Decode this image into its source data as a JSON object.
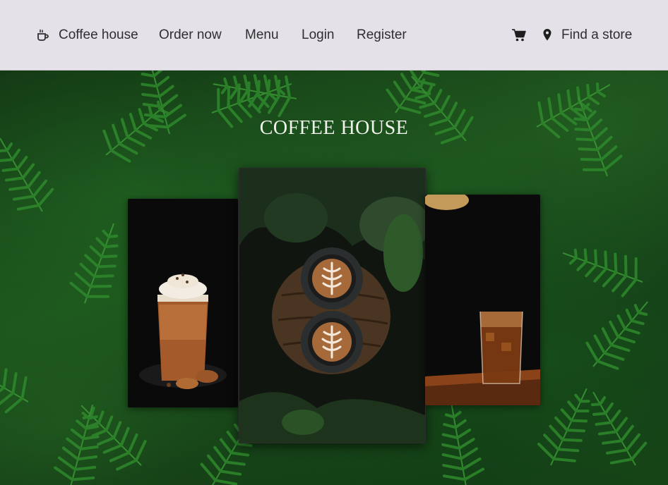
{
  "nav": {
    "brand_label": "Coffee house",
    "order_label": "Order now",
    "menu_label": "Menu",
    "login_label": "Login",
    "register_label": "Register",
    "store_label": "Find a store",
    "brand_icon": "coffee-cup-icon",
    "cart_icon": "cart-icon",
    "store_icon": "map-pin-icon"
  },
  "hero": {
    "title": "COFFEE HOUSE",
    "images": [
      {
        "name": "iced-mocha-photo",
        "subject": "iced coffee with whipped cream and cookies"
      },
      {
        "name": "latte-art-photo",
        "subject": "two latte art cups on wooden tray"
      },
      {
        "name": "cold-brew-photo",
        "subject": "glass of iced cold brew"
      }
    ]
  },
  "colors": {
    "navbar_bg": "#e4e1e8",
    "nav_text": "#2f2f2f",
    "hero_title": "#f3f3ee",
    "fern_green": "#2f8a2c"
  }
}
